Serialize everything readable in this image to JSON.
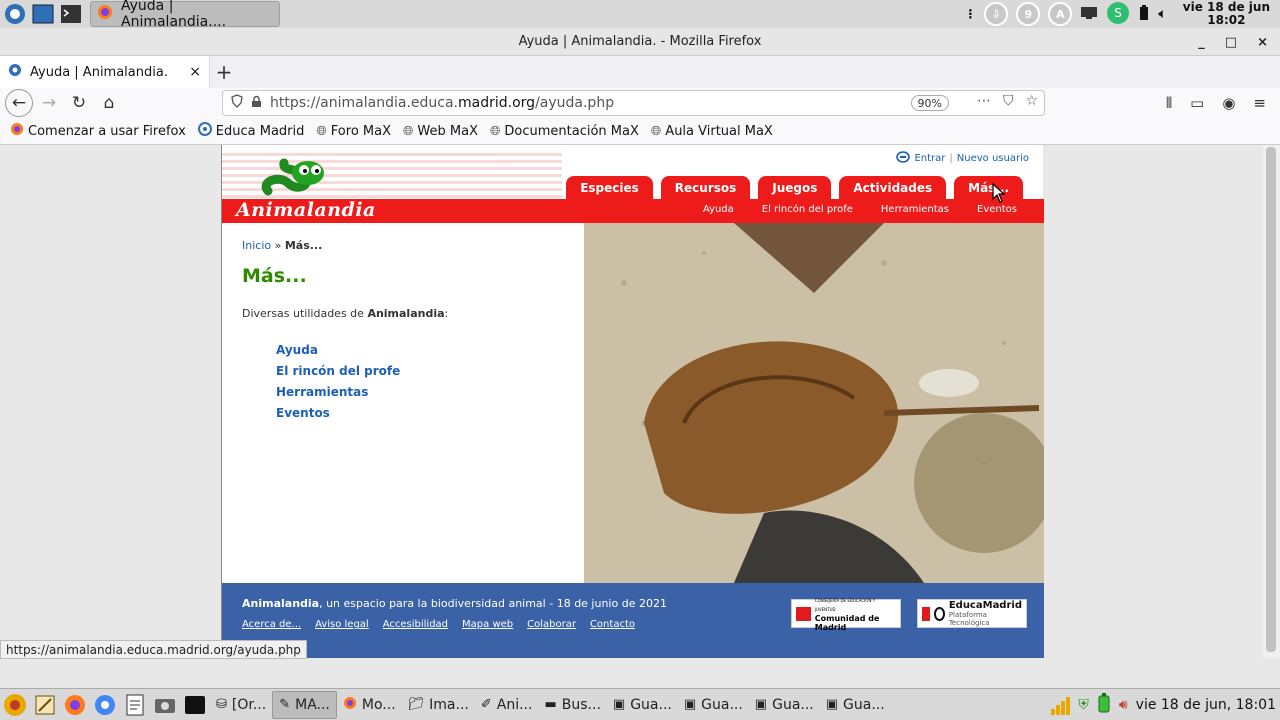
{
  "system_panel": {
    "active_window_task": "Ayuda | Animalandia....",
    "tray_badges": [
      "9",
      "A"
    ],
    "clock_top": "vie 18 de jun",
    "clock_bottom": "18:02"
  },
  "window": {
    "title": "Ayuda | Animalandia. - Mozilla Firefox",
    "controls": [
      "_",
      "□",
      "×"
    ]
  },
  "tab": {
    "label": "Ayuda | Animalandia.",
    "close": "×",
    "new_tab": "+"
  },
  "urlbar": {
    "prefix": "https://animalandia.educa.",
    "host": "madrid.org",
    "path": "/ayuda.php",
    "zoom": "90%"
  },
  "bookmarks": [
    {
      "label": "Comenzar a usar Firefox",
      "icon": "firefox-icon"
    },
    {
      "label": "Educa Madrid",
      "icon": "gear-icon"
    },
    {
      "label": "Foro MaX",
      "icon": "globe-icon"
    },
    {
      "label": "Web MaX",
      "icon": "globe-icon"
    },
    {
      "label": "Documentación MaX",
      "icon": "globe-icon"
    },
    {
      "label": "Aula Virtual MaX",
      "icon": "globe-icon"
    }
  ],
  "site": {
    "logo_text": "Animalandia",
    "login": {
      "enter": "Entrar",
      "separator": "|",
      "new_user": "Nuevo usuario"
    },
    "main_tabs": [
      "Especies",
      "Recursos",
      "Juegos",
      "Actividades",
      "Más..."
    ],
    "sub_tabs": [
      "Ayuda",
      "El rincón del profe",
      "Herramientas",
      "Eventos"
    ],
    "breadcrumb": {
      "home": "Inicio",
      "sep": " » ",
      "current": "Más..."
    },
    "page_title": "Más...",
    "intro_prefix": "Diversas utilidades de ",
    "intro_bold": "Animalandia",
    "intro_suffix": ":",
    "links": [
      "Ayuda",
      "El rincón del profe",
      "Herramientas",
      "Eventos"
    ],
    "footer": {
      "brand": "Animalandia",
      "tagline": ", un espacio para la biodiversidad animal - 18 de junio de 2021",
      "links": [
        "Acerca de...",
        "Aviso legal",
        "Accesibilidad",
        "Mapa web",
        "Colaborar",
        "Contacto"
      ],
      "badge_cm_top": "CONSEJERÍA DE EDUCACIÓN Y JUVENTUD",
      "badge_cm_bottom": "Comunidad de Madrid",
      "badge_em_name": "EducaMadrid",
      "badge_em_sub": "Plataforma Tecnológica"
    }
  },
  "status_tooltip": "https://animalandia.educa.madrid.org/ayuda.php",
  "taskbar": {
    "tasks": [
      "[Or...",
      "MA...",
      "Mo...",
      "Ima...",
      "Ani...",
      "Bus...",
      "Gua...",
      "Gua...",
      "Gua...",
      "Gua..."
    ],
    "clock": "vie 18 de jun, 18:01"
  },
  "colors": {
    "site_red": "#ee1b1b",
    "title_green": "#2e8b00",
    "link_blue": "#1d5fb6",
    "footer_blue": "#3b62a6"
  }
}
